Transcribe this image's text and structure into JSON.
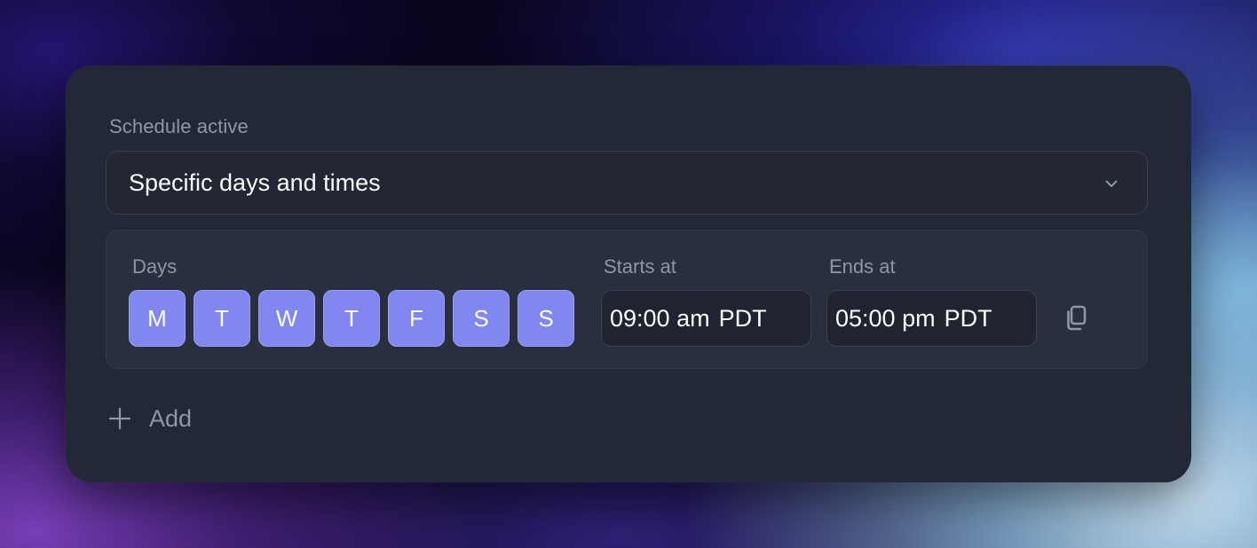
{
  "schedule": {
    "label": "Schedule active",
    "select_value": "Specific days and times"
  },
  "row": {
    "days_label": "Days",
    "days": [
      "M",
      "T",
      "W",
      "T",
      "F",
      "S",
      "S"
    ],
    "starts_label": "Starts at",
    "start_time": "09:00 am",
    "start_tz": "PDT",
    "ends_label": "Ends at",
    "end_time": "05:00 pm",
    "end_tz": "PDT"
  },
  "add": {
    "label": "Add"
  },
  "icons": {
    "select": "chevron-down-icon",
    "copy": "copy-icon",
    "add": "plus-icon"
  },
  "colors": {
    "card": "#232836",
    "day_selected": "#8087ee",
    "muted_text": "#8f96aa"
  }
}
